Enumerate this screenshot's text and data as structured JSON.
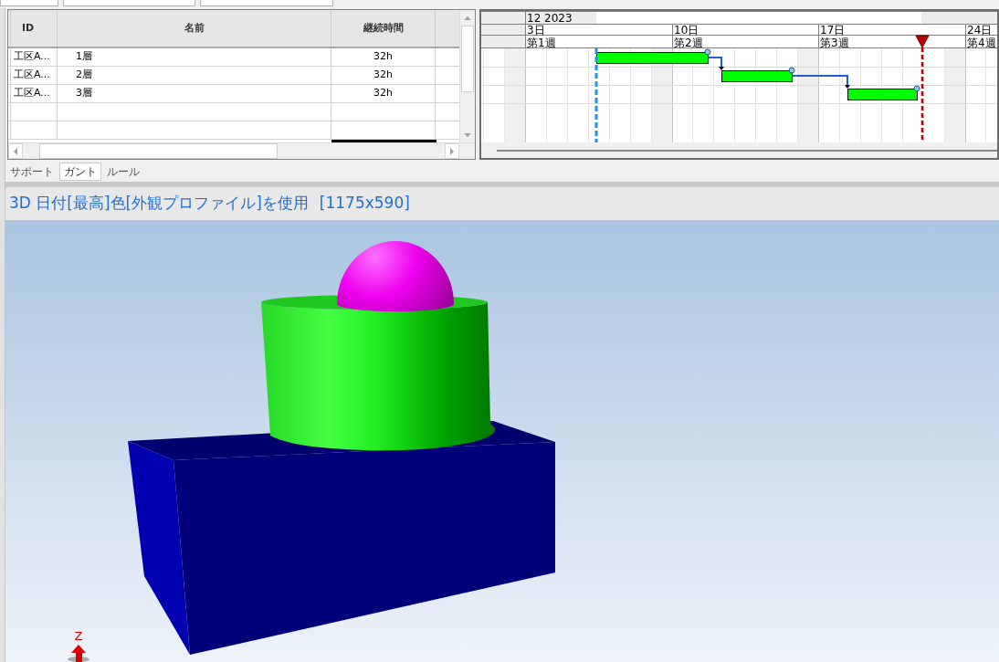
{
  "table": {
    "columns": [
      "ID",
      "名前",
      "継続時間"
    ],
    "rows": [
      {
        "id": "工区A...",
        "name": "1層",
        "duration": "32h"
      },
      {
        "id": "工区A...",
        "name": "2層",
        "duration": "32h"
      },
      {
        "id": "工区A...",
        "name": "3層",
        "duration": "32h"
      }
    ]
  },
  "gantt": {
    "month": "12 2023",
    "days": [
      "3日",
      "10日",
      "17日",
      "24日"
    ],
    "weeks": [
      "第1週",
      "第2週",
      "第3週",
      "第4週"
    ]
  },
  "tabs": [
    {
      "label": "サポート",
      "selected": false
    },
    {
      "label": "ガント",
      "selected": true
    },
    {
      "label": "ルール",
      "selected": false
    }
  ],
  "viewport": {
    "title": "3D 日付[最高]色[外観プロファイル]を使用",
    "size": "[1175x590]",
    "axis_label": "Z"
  }
}
